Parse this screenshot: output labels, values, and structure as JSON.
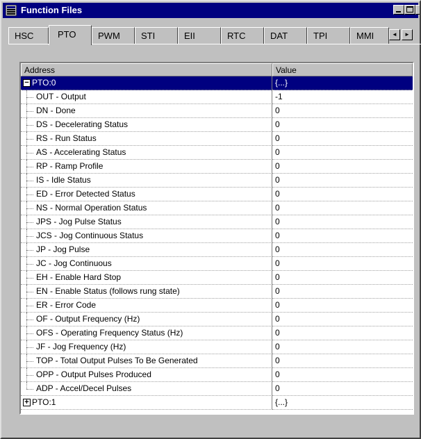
{
  "window": {
    "title": "Function Files",
    "min_label": "_",
    "max_label": "□",
    "close_label": "X"
  },
  "tabs": [
    {
      "label": "HSC"
    },
    {
      "label": "PTO"
    },
    {
      "label": "PWM"
    },
    {
      "label": "STI"
    },
    {
      "label": "EII"
    },
    {
      "label": "RTC"
    },
    {
      "label": "DAT"
    },
    {
      "label": "TPI"
    },
    {
      "label": "MMI"
    }
  ],
  "active_tab": "PTO",
  "tab_scroll": {
    "left": "◄",
    "right": "►"
  },
  "grid": {
    "col_address": "Address",
    "col_value": "Value",
    "rows": [
      {
        "address": "PTO:0",
        "value": "{...}",
        "kind": "group",
        "expanded": true,
        "selected": true
      },
      {
        "address": "OUT - Output",
        "value": "-1"
      },
      {
        "address": "DN - Done",
        "value": "0"
      },
      {
        "address": "DS - Decelerating Status",
        "value": "0"
      },
      {
        "address": "RS - Run Status",
        "value": "0"
      },
      {
        "address": "AS - Accelerating Status",
        "value": "0"
      },
      {
        "address": "RP - Ramp Profile",
        "value": "0"
      },
      {
        "address": "IS - Idle Status",
        "value": "0"
      },
      {
        "address": "ED - Error Detected Status",
        "value": "0"
      },
      {
        "address": "NS - Normal Operation Status",
        "value": "0"
      },
      {
        "address": "JPS - Jog Pulse Status",
        "value": "0"
      },
      {
        "address": "JCS - Jog Continuous Status",
        "value": "0"
      },
      {
        "address": "JP - Jog Pulse",
        "value": "0"
      },
      {
        "address": "JC - Jog Continuous",
        "value": "0"
      },
      {
        "address": "EH - Enable Hard Stop",
        "value": "0"
      },
      {
        "address": "EN - Enable Status (follows rung state)",
        "value": "0"
      },
      {
        "address": "ER - Error Code",
        "value": "0"
      },
      {
        "address": "OF - Output Frequency (Hz)",
        "value": "0"
      },
      {
        "address": "OFS - Operating Frequency Status (Hz)",
        "value": "0"
      },
      {
        "address": "JF - Jog Frequency (Hz)",
        "value": "0"
      },
      {
        "address": "TOP - Total Output Pulses To Be Generated",
        "value": "0"
      },
      {
        "address": "OPP - Output Pulses Produced",
        "value": "0"
      },
      {
        "address": "ADP - Accel/Decel Pulses",
        "value": "0"
      },
      {
        "address": "PTO:1",
        "value": "{...}",
        "kind": "group",
        "expanded": false
      }
    ]
  },
  "colors": {
    "title_bar": "#000080",
    "selection": "#000080",
    "face": "#c0c0c0"
  }
}
